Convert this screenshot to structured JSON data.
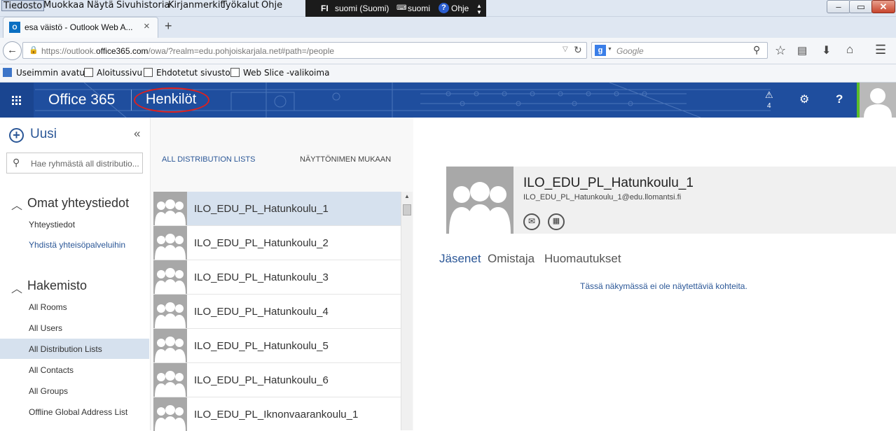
{
  "menubar": {
    "items": [
      "Tiedosto",
      "Muokkaa",
      "Näytä",
      "Sivuhistoria",
      "Kirjanmerkit",
      "Työkalut",
      "Ohje"
    ],
    "lang_code": "FI",
    "lang_name": "suomi (Suomi)",
    "keyboard": "suomi",
    "help": "Ohje"
  },
  "tab": {
    "title": "esa väistö - Outlook Web A...",
    "close": "×",
    "new": "+"
  },
  "nav": {
    "url_prefix": "https://outlook.",
    "url_domain": "office365.com",
    "url_rest": "/owa/?realm=edu.pohjoiskarjala.net#path=/people",
    "search_placeholder": "Google"
  },
  "bookmarks": [
    "Useimmin avatut",
    "Aloitussivu",
    "Ehdotetut sivustot",
    "Web Slice -valikoima"
  ],
  "header": {
    "brand": "Office 365",
    "app": "Henkilöt",
    "alerts_count": "4",
    "help": "?"
  },
  "sidebar": {
    "new_label": "Uusi",
    "collapse": "«",
    "search_placeholder": "Hae ryhmästä all distributio...",
    "section1": "Omat yhteystiedot",
    "section1_items": [
      "Yhteystiedot",
      "Yhdistä yhteisöpalveluihin"
    ],
    "section2": "Hakemisto",
    "section2_items": [
      "All Rooms",
      "All Users",
      "All Distribution Lists",
      "All Contacts",
      "All Groups",
      "Offline Global Address List"
    ],
    "selected": "All Distribution Lists"
  },
  "list": {
    "title": "ALL DISTRIBUTION LISTS",
    "sort": "NÄYTTÖNIMEN MUKAAN",
    "items": [
      "ILO_EDU_PL_Hatunkoulu_1",
      "ILO_EDU_PL_Hatunkoulu_2",
      "ILO_EDU_PL_Hatunkoulu_3",
      "ILO_EDU_PL_Hatunkoulu_4",
      "ILO_EDU_PL_Hatunkoulu_5",
      "ILO_EDU_PL_Hatunkoulu_6",
      "ILO_EDU_PL_Iknonvaarankoulu_1"
    ]
  },
  "detail": {
    "name": "ILO_EDU_PL_Hatunkoulu_1",
    "email": "ILO_EDU_PL_Hatunkoulu_1@edu.llomantsi.fi",
    "tabs": [
      "Jäsenet",
      "Omistaja",
      "Huomautukset"
    ],
    "empty": "Tässä näkymässä ei ole näytettäviä kohteita."
  },
  "colors": {
    "header_bg": "#1f4e9e",
    "accent": "#2b5797",
    "selected_row": "#d6e1ee"
  }
}
